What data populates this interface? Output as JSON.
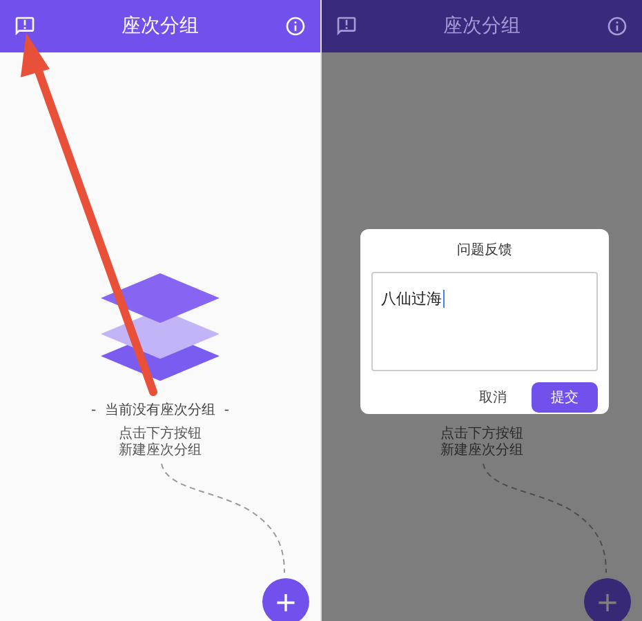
{
  "screens": [
    {
      "header": {
        "title": "座次分组"
      },
      "empty_title": "-  当前没有座次分组  -",
      "hint_lines": [
        "点击下方按钮",
        "新建座次分组"
      ],
      "fab": "+",
      "dimmed": false
    },
    {
      "header": {
        "title": "座次分组"
      },
      "hint_lines": [
        "点击下方按钮",
        "新建座次分组"
      ],
      "fab": "+",
      "dimmed": true,
      "dialog": {
        "title": "问题反馈",
        "value": "八仙过海",
        "buttons": [
          {
            "label": "取消",
            "kind": "text"
          },
          {
            "label": "提交",
            "kind": "primary"
          }
        ]
      }
    }
  ],
  "annotation": {
    "kind": "arrow"
  }
}
